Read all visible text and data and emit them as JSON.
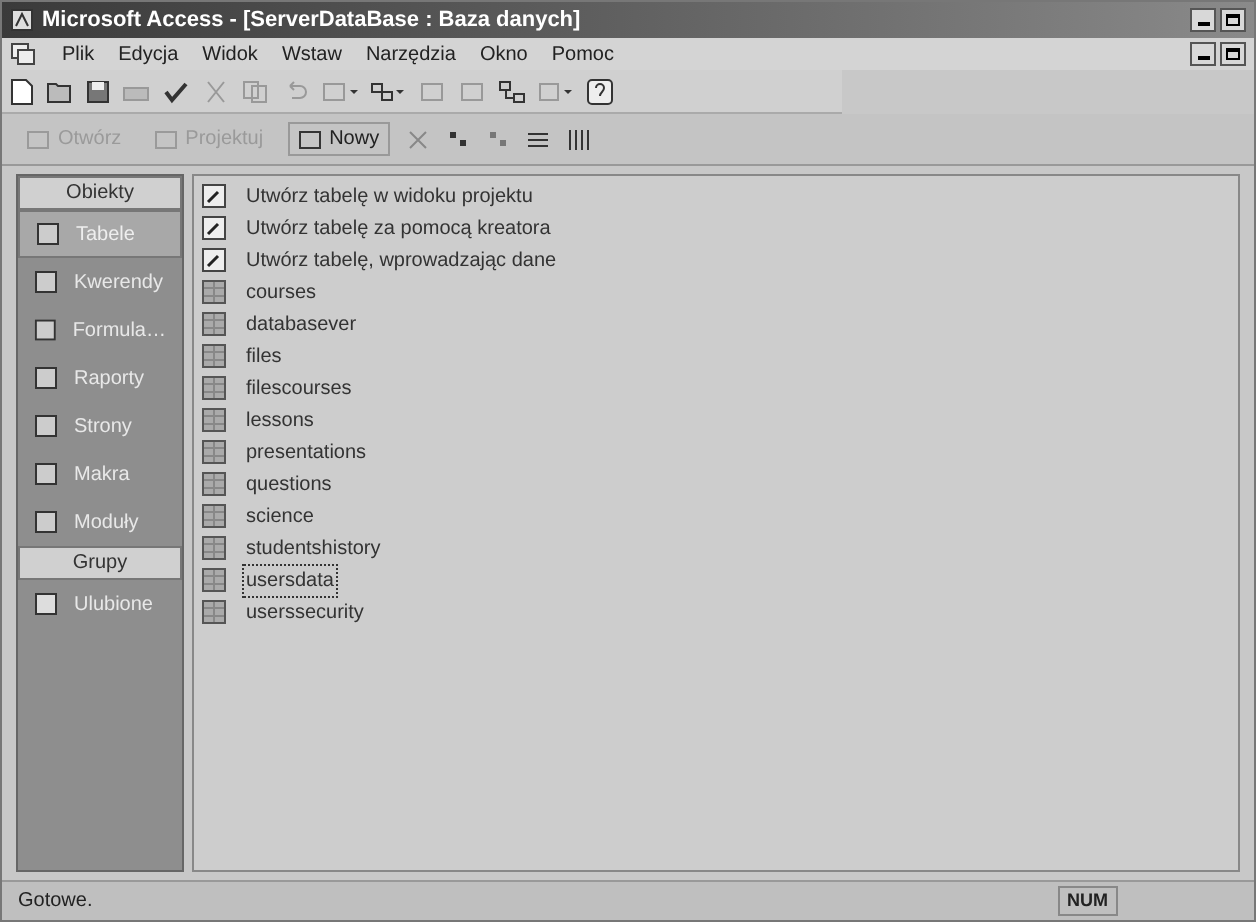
{
  "window": {
    "title": "Microsoft Access - [ServerDataBase : Baza danych]"
  },
  "menu": [
    {
      "label": "Plik"
    },
    {
      "label": "Edycja"
    },
    {
      "label": "Widok"
    },
    {
      "label": "Wstaw"
    },
    {
      "label": "Narzędzia"
    },
    {
      "label": "Okno"
    },
    {
      "label": "Pomoc"
    }
  ],
  "db_toolbar": [
    {
      "label": "Otwórz",
      "disabled": true
    },
    {
      "label": "Projektuj",
      "disabled": true
    },
    {
      "label": "Nowy",
      "disabled": false
    }
  ],
  "sidebar": {
    "objects_header": "Obiekty",
    "items": [
      {
        "label": "Tabele",
        "selected": true
      },
      {
        "label": "Kwerendy",
        "selected": false
      },
      {
        "label": "Formula…",
        "selected": false
      },
      {
        "label": "Raporty",
        "selected": false
      },
      {
        "label": "Strony",
        "selected": false
      },
      {
        "label": "Makra",
        "selected": false
      },
      {
        "label": "Moduły",
        "selected": false
      }
    ],
    "groups_header": "Grupy",
    "groups": [
      {
        "label": "Ulubione"
      }
    ]
  },
  "list": [
    {
      "kind": "shortcut",
      "label": "Utwórz tabelę w widoku projektu",
      "selected": false
    },
    {
      "kind": "shortcut",
      "label": "Utwórz tabelę za pomocą kreatora",
      "selected": false
    },
    {
      "kind": "shortcut",
      "label": "Utwórz tabelę, wprowadzając dane",
      "selected": false
    },
    {
      "kind": "table",
      "label": "courses",
      "selected": false
    },
    {
      "kind": "table",
      "label": "databasever",
      "selected": false
    },
    {
      "kind": "table",
      "label": "files",
      "selected": false
    },
    {
      "kind": "table",
      "label": "filescourses",
      "selected": false
    },
    {
      "kind": "table",
      "label": "lessons",
      "selected": false
    },
    {
      "kind": "table",
      "label": "presentations",
      "selected": false
    },
    {
      "kind": "table",
      "label": "questions",
      "selected": false
    },
    {
      "kind": "table",
      "label": "science",
      "selected": false
    },
    {
      "kind": "table",
      "label": "studentshistory",
      "selected": false
    },
    {
      "kind": "table",
      "label": "usersdata",
      "selected": true
    },
    {
      "kind": "table",
      "label": "userssecurity",
      "selected": false
    }
  ],
  "status_bar": {
    "text": "Gotowe.",
    "indicator": "NUM"
  }
}
